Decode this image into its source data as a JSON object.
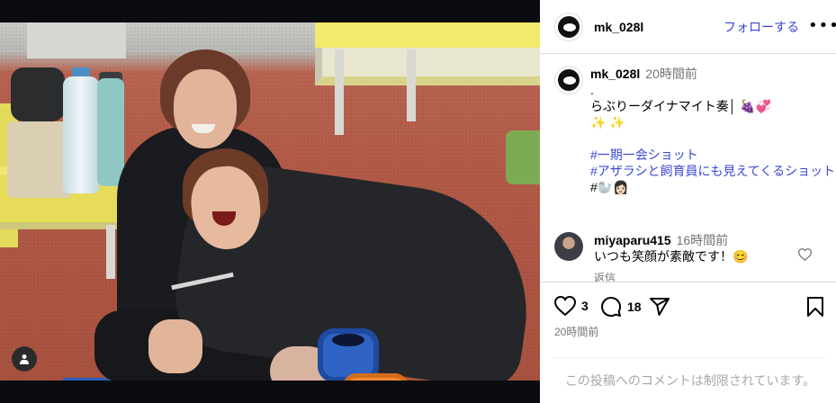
{
  "post": {
    "username": "mk_028l",
    "follow_label": "フォローする",
    "more_label": "•••"
  },
  "caption": {
    "username": "mk_028l",
    "time": "20時間前",
    "dot": ".",
    "line1": "らぶりーダイナマイト奏│ 🍇💞",
    "line2": "✨ ✨",
    "hashtag1": "#一期一会ショット",
    "hashtag2": "#アザラシと飼育員にも見えてくるショット",
    "hashtag3": "#🦭👩🏻"
  },
  "comment": {
    "username": "miyaparu415",
    "time": "16時間前",
    "text": "いつも笑顔が素敵です！😊",
    "reply_label": "返信"
  },
  "actions": {
    "likes": "3",
    "comments": "18",
    "posted": "20時間前"
  },
  "footer": {
    "disabled_text": "この投稿へのコメントは制限されています。"
  },
  "colors": {
    "link": "#3a46d6",
    "muted": "#737373",
    "border": "#dbdbdb"
  },
  "icons": [
    "user-tag-icon",
    "more-icon",
    "heart-icon",
    "comment-icon",
    "share-icon",
    "bookmark-icon"
  ]
}
